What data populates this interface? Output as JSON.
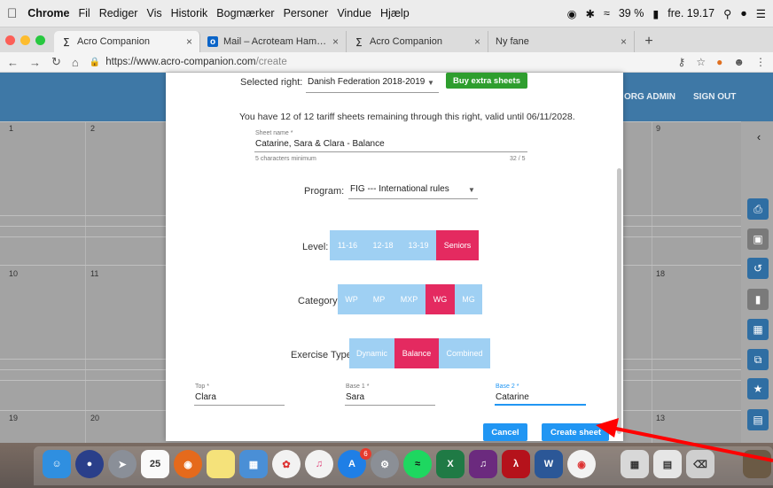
{
  "menubar": {
    "app": "Chrome",
    "items": [
      "Fil",
      "Rediger",
      "Vis",
      "Historik",
      "Bogmærker",
      "Personer",
      "Vindue",
      "Hjælp"
    ],
    "battery": "39 %",
    "clock": "fre. 19.17"
  },
  "tabs": [
    {
      "title": "Acro Companion",
      "icon": "acro-logo-icon"
    },
    {
      "title": "Mail – Acroteam Hammel – Out",
      "icon": "outlook-icon"
    },
    {
      "title": "Acro Companion",
      "icon": "acro-logo-icon"
    },
    {
      "title": "Ny fane",
      "icon": ""
    }
  ],
  "address": {
    "url_host": "https://www.acro-companion.com",
    "url_path": "/create"
  },
  "header": {
    "org_admin": "ORG ADMIN",
    "sign_out": "SIGN OUT"
  },
  "calendar": {
    "day_numbers": [
      "1",
      "2",
      "9",
      "10",
      "11",
      "18",
      "19",
      "20",
      "13"
    ]
  },
  "modal": {
    "selected_right_label": "Selected right:",
    "selected_right_value": "Danish Federation 2018-2019",
    "buy_button": "Buy extra sheets",
    "remaining_text": "You have 12 of 12 tariff sheets remaining through this right, valid until 06/11/2028.",
    "sheet_name_label": "Sheet name *",
    "sheet_name_value": "Catarine, Sara & Clara - Balance",
    "sheet_name_hint": "5 characters minimum",
    "sheet_name_counter": "32 / 5",
    "program_label": "Program:",
    "program_value": "FIG --- International rules",
    "level_label": "Level:",
    "levels": [
      "11-16",
      "12-18",
      "13-19",
      "Seniors"
    ],
    "level_selected": "Seniors",
    "category_label": "Category:",
    "categories": [
      "WP",
      "MP",
      "MXP",
      "WG",
      "MG"
    ],
    "category_selected": "WG",
    "exercise_label": "Exercise Type:",
    "exercise_types": [
      "Dynamic",
      "Balance",
      "Combined"
    ],
    "exercise_selected": "Balance",
    "top_label": "Top *",
    "top_value": "Clara",
    "base1_label": "Base 1 *",
    "base1_value": "Sara",
    "base2_label": "Base 2 *",
    "base2_value": "Catarine",
    "cancel_button": "Cancel",
    "create_button": "Create sheet"
  },
  "dock": {
    "calendar_day": "25",
    "badge": "6"
  },
  "colors": {
    "accent_blue": "#2196f3",
    "selected_pink": "#e42a60",
    "unselected_blue": "#9fd0f3",
    "buy_green": "#2e9e2e",
    "header_blue": "#3e78a6",
    "annotation_red": "#ff0000"
  }
}
